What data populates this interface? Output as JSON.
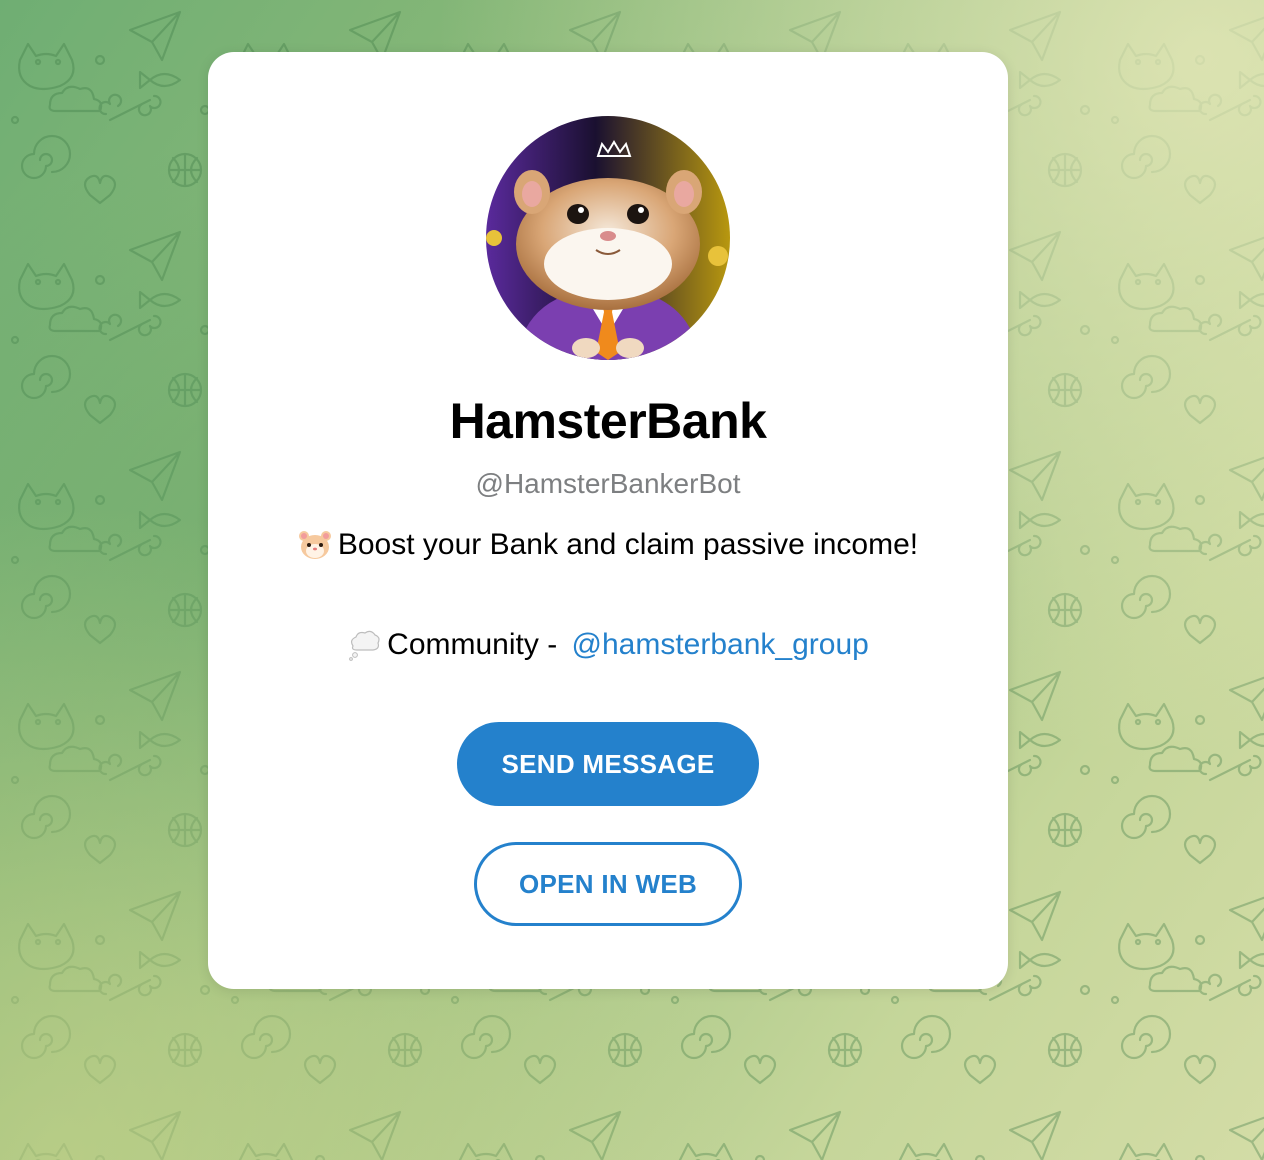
{
  "profile": {
    "name": "HamsterBank",
    "username": "@HamsterBankerBot",
    "description_line1": "Boost your Bank and claim passive income!",
    "description_line1_emoji": "hamster-face-emoji",
    "description_line2_prefix": "Community - ",
    "description_line2_emoji": "thought-balloon-emoji",
    "community_link": "@hamsterbank_group"
  },
  "actions": {
    "send_message": "SEND MESSAGE",
    "open_in_web": "OPEN IN WEB"
  },
  "colors": {
    "accent": "#2481cc",
    "username_gray": "#7d7f81",
    "card_bg": "#ffffff",
    "background_green": "#88b878"
  }
}
